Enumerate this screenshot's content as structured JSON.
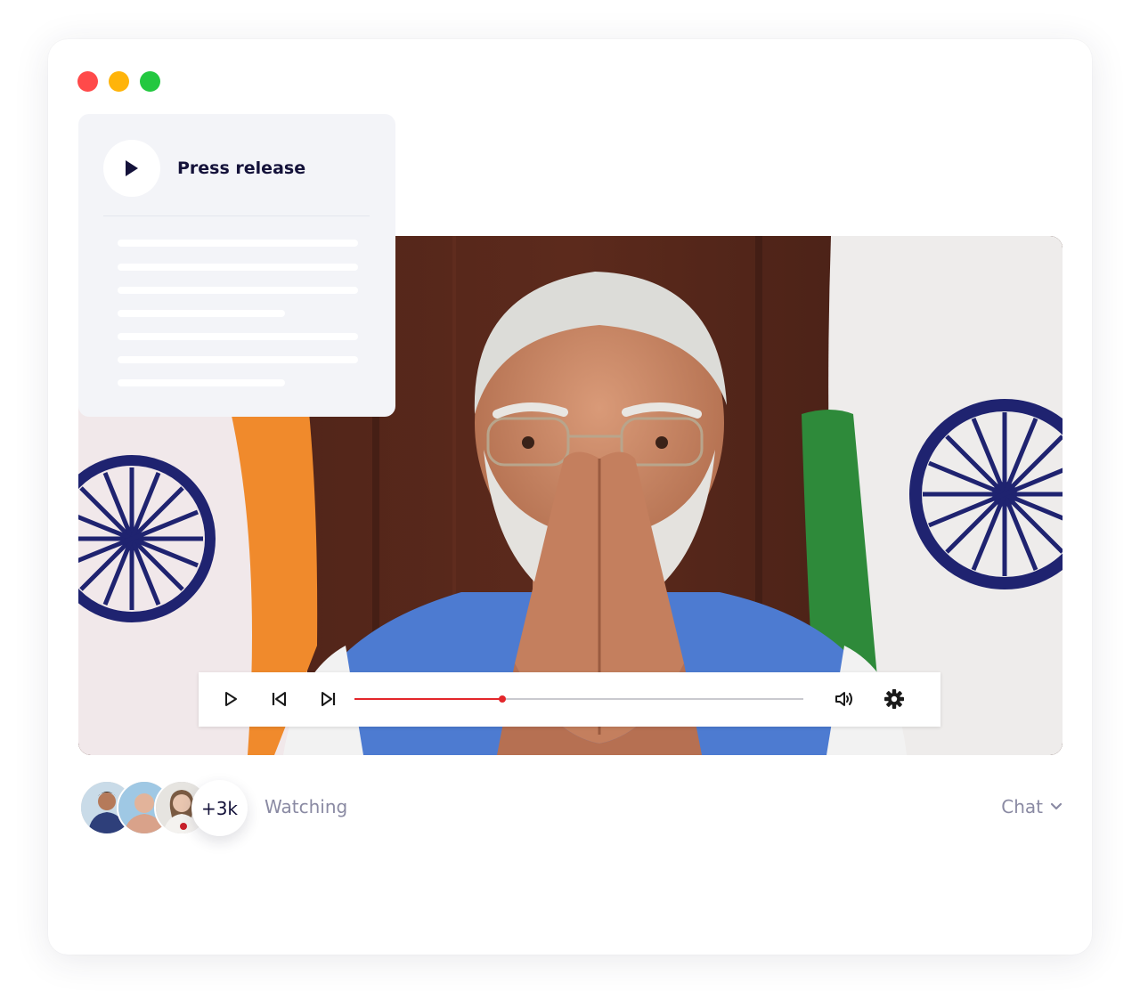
{
  "window": {
    "controls": [
      {
        "name": "close",
        "color": "#ff4a4a"
      },
      {
        "name": "minimize",
        "color": "#ffb40a"
      },
      {
        "name": "maximize",
        "color": "#23c840"
      }
    ]
  },
  "press_card": {
    "title": "Press release",
    "play_icon": "play-icon"
  },
  "player": {
    "controls": {
      "play_icon": "play-icon",
      "prev_icon": "skip-back-icon",
      "next_icon": "skip-forward-icon",
      "volume_icon": "volume-icon",
      "settings_icon": "gear-icon"
    },
    "progress": 0.33,
    "colors": {
      "progress": "#e3262b",
      "track": "#c9c9cf"
    }
  },
  "audience": {
    "count_label": "+3k",
    "watching_label": "Watching"
  },
  "chat": {
    "label": "Chat",
    "icon": "chevron-down-icon"
  }
}
